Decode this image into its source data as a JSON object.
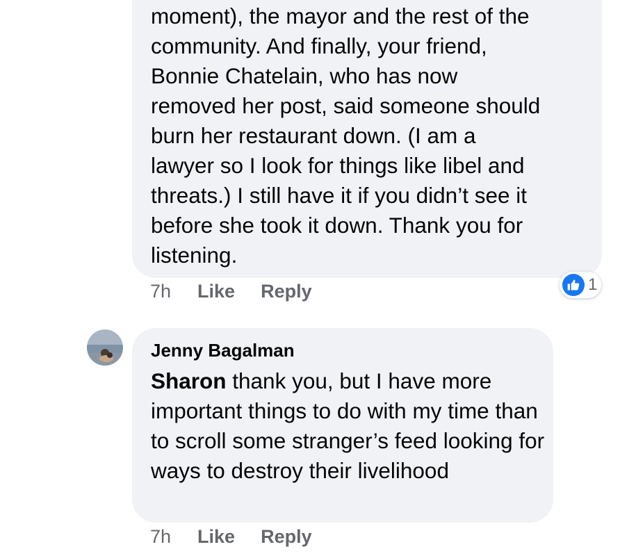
{
  "comments": [
    {
      "text": "moment), the mayor and the rest of the\ncommunity. And  finally, your friend,\nBonnie Chatelain, who has now\nremoved her post, said someone should\nburn her restaurant down. (I am a\nlawyer so I look for things like libel and\nthreats.) I still have it if you didn’t see it\nbefore she took it down. Thank you for\nlistening.",
      "time": "7h",
      "like_label": "Like",
      "reply_label": "Reply",
      "reaction_count": "1",
      "reaction_icon": "thumbs-up-icon"
    },
    {
      "author": "Jenny Bagalman",
      "mention": "Sharon",
      "text": " thank you, but I have more important things to do with my time than to scroll some stranger’s feed looking for ways to destroy their livelihood",
      "time": "7h",
      "like_label": "Like",
      "reply_label": "Reply"
    }
  ],
  "colors": {
    "bubble": "#f0f2f5",
    "meta_text": "#65676b",
    "like_blue": "#1877f2"
  }
}
